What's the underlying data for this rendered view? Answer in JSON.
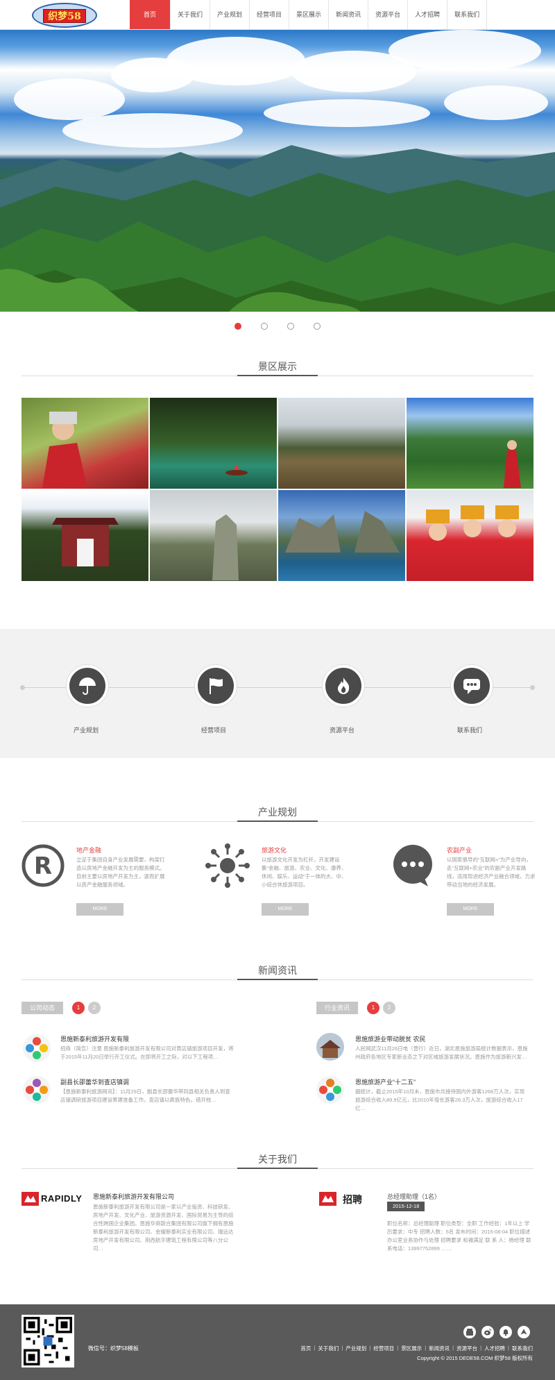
{
  "header": {
    "logo_text": "织梦58",
    "nav": [
      {
        "label": "首页",
        "active": true
      },
      {
        "label": "关于我们"
      },
      {
        "label": "产业规划"
      },
      {
        "label": "经营项目"
      },
      {
        "label": "景区展示"
      },
      {
        "label": "新闻资讯"
      },
      {
        "label": "资源平台"
      },
      {
        "label": "人才招聘"
      },
      {
        "label": "联系我们"
      }
    ]
  },
  "banner": {
    "slides": 4,
    "active_slide": 1
  },
  "scenic": {
    "title": "景区展示"
  },
  "features": [
    {
      "label": "产业规划",
      "icon": "umbrella-icon"
    },
    {
      "label": "经营项目",
      "icon": "flag-icon"
    },
    {
      "label": "资源平台",
      "icon": "flame-icon"
    },
    {
      "label": "联系我们",
      "icon": "chat-icon"
    }
  ],
  "industry": {
    "title": "产业规划",
    "items": [
      {
        "icon": "registered-icon",
        "title": "地产金融",
        "text": "立足于集团自身产业发展需要，构架打造以房地产金融开发为主的服务模式。目前主要以房地产开发为主，逐而扩展以房产金融服务领域。",
        "more": "MORE"
      },
      {
        "icon": "sun-icon",
        "title": "旅游文化",
        "text": "以旅游文化开发为杠杆，开发建设集“金融、旅游、农业、文化、康养、休闲、娱乐、运动”于一体的大、中、小综合休旅游项目。",
        "more": "MORE"
      },
      {
        "icon": "speech-icon",
        "title": "农副产业",
        "text": "以国家倡导的“互联网+”为产业导向，走“互联网+农业”的农副产业开发路线，适用现进经济产业融合领域，力求带动当地的经济发展。",
        "more": "MORE"
      }
    ]
  },
  "news": {
    "title": "新闻资讯",
    "left": {
      "tab": "公司动态",
      "pages": [
        "1",
        "2"
      ],
      "items": [
        {
          "title": "恩施新泰利旅游开发有限",
          "text": "招商（简告）注意 恩施新泰利旅游开发有限公司对黄店镇旅游项目开发，将于2015年11月20日举行开工仪式。在即将开工之际，对以下工程项…"
        },
        {
          "title": "副县长邵蕾华到查店镇调",
          "text": "【恩施新泰利旅游网讯】：11月29日，副县长邵蕾华带同县相关负责人到查店镇调研旅游项目建设筹建准备工作。查店镇以彝族特色，错开枝…"
        }
      ]
    },
    "right": {
      "tab": "行业资讯",
      "pages": [
        "1",
        "2"
      ],
      "items": [
        {
          "title": "恩施旅游业带动脱贫 农民",
          "text": "人民网武汉11月26日电（曾行）近日，湖北恩施旅游局统计数据表示，恩施州政府各地区专家新业态之下对区域旅游发展状况。恩施作为旅游新兴发…"
        },
        {
          "title": "恩施旅游产业“十二五”",
          "text": "据统计，截止2015年10月末，恩施市共接待国内外游客1268万人次，实现旅游综合收入89.9亿元，比2010年增长游客26.3万人次，旅游综合收入17亿…"
        }
      ]
    }
  },
  "about": {
    "title": "关于我们",
    "company": {
      "logo": "RAPIDLY",
      "name": "恩施新泰利旅游开发有限公司",
      "text": "恩施新泰利旅游开发有限公司是一家以产业投资、科技研发、房地产开发、文化产业、旅游资源开发、国际贸易为主导的综合性跨国企业集团。恩施华商联合集团有限公司旗下拥有恩施新泰利旅游开发有限公司、金耀新泰利实业有限公司、瑞远达房地产开发有限公司、荆西航宇建筑工程有限公司等八分公司…"
    },
    "jobs": {
      "logo": "招聘",
      "title": "总经理助理（1名）",
      "date": "2015-12-18",
      "text": "职位名称：总经理助理 职位类型：全职 工作经验：1年以上 学历要求：中专 招聘人数：5名 发布时间：2015-08-04 职位描述办公室业务协作与处理 招聘要求 和福满足 联 系 人：杨经理 联系电话：13997752899 ……"
    }
  },
  "footer": {
    "wechat": "微信号：织梦58模板",
    "links": [
      "首页",
      "关于我们",
      "产业规划",
      "经营项目",
      "景区展示",
      "新闻资讯",
      "资源平台",
      "人才招聘",
      "联系我们"
    ],
    "copyright": "Copyright © 2015 DEDE58.COM 织梦58 版权所有"
  }
}
